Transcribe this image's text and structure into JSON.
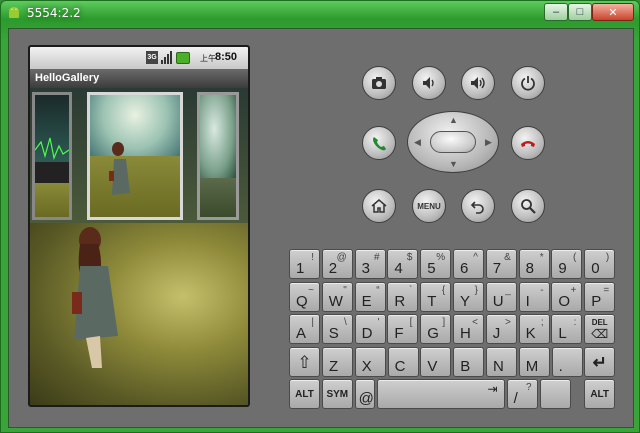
{
  "window": {
    "title": "5554:2.2"
  },
  "statusbar": {
    "network": "3G",
    "ampm": "上午",
    "time": "8:50"
  },
  "app": {
    "title": "HelloGallery"
  },
  "controls": {
    "menu_label": "MENU"
  },
  "keyboard": {
    "rows": [
      [
        {
          "main": "1",
          "alt": "!"
        },
        {
          "main": "2",
          "alt": "@"
        },
        {
          "main": "3",
          "alt": "#"
        },
        {
          "main": "4",
          "alt": "$"
        },
        {
          "main": "5",
          "alt": "%"
        },
        {
          "main": "6",
          "alt": "^"
        },
        {
          "main": "7",
          "alt": "&"
        },
        {
          "main": "8",
          "alt": "*"
        },
        {
          "main": "9",
          "alt": "("
        },
        {
          "main": "0",
          "alt": ")"
        }
      ],
      [
        {
          "main": "Q",
          "alt": "~"
        },
        {
          "main": "W",
          "alt": "\""
        },
        {
          "main": "E",
          "alt": "“"
        },
        {
          "main": "R",
          "alt": "`"
        },
        {
          "main": "T",
          "alt": "{"
        },
        {
          "main": "Y",
          "alt": "}"
        },
        {
          "main": "U",
          "alt": "_"
        },
        {
          "main": "I",
          "alt": "-"
        },
        {
          "main": "O",
          "alt": "+"
        },
        {
          "main": "P",
          "alt": "="
        }
      ],
      [
        {
          "main": "A",
          "alt": "|"
        },
        {
          "main": "S",
          "alt": "\\"
        },
        {
          "main": "D",
          "alt": "'"
        },
        {
          "main": "F",
          "alt": "["
        },
        {
          "main": "G",
          "alt": "]"
        },
        {
          "main": "H",
          "alt": "<"
        },
        {
          "main": "J",
          "alt": ">"
        },
        {
          "main": "K",
          "alt": ";"
        },
        {
          "main": "L",
          "alt": ":"
        }
      ],
      [
        {
          "main": "Z",
          "alt": ""
        },
        {
          "main": "X",
          "alt": ""
        },
        {
          "main": "C",
          "alt": ""
        },
        {
          "main": "V",
          "alt": ""
        },
        {
          "main": "B",
          "alt": ""
        },
        {
          "main": "N",
          "alt": ""
        },
        {
          "main": "M",
          "alt": ""
        },
        {
          "main": ".",
          "alt": ""
        }
      ],
      [
        {
          "main": "/",
          "alt": "?"
        }
      ]
    ],
    "del_label": "DEL",
    "alt_label": "ALT",
    "sym_label": "SYM",
    "at_label": "@"
  }
}
